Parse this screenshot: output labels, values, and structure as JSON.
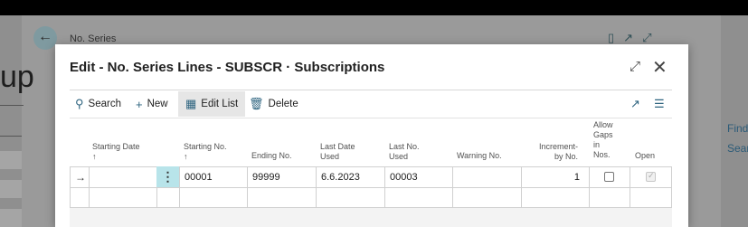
{
  "background": {
    "page_title": "No. Series",
    "partial_heading": "up",
    "right_links": [
      "Find",
      "Sear"
    ]
  },
  "dialog": {
    "title": "Edit - No. Series Lines - SUBSCR · Subscriptions",
    "toolbar": {
      "search": "Search",
      "new": "New",
      "edit_list": "Edit List",
      "delete": "Delete"
    },
    "columns": {
      "starting_date": "Starting Date",
      "starting_date_sort": "↑",
      "starting_no": "Starting No.",
      "starting_no_sort": "↑",
      "ending_no": "Ending No.",
      "last_date_used_1": "Last Date",
      "last_date_used_2": "Used",
      "last_no_used_1": "Last No.",
      "last_no_used_2": "Used",
      "warning_no": "Warning No.",
      "increment_1": "Increment-",
      "increment_2": "by No.",
      "allow_gaps_1": "Allow",
      "allow_gaps_2": "Gaps",
      "allow_gaps_3": "in",
      "allow_gaps_4": "Nos.",
      "open": "Open"
    },
    "rows": [
      {
        "starting_date": "",
        "starting_no": "00001",
        "ending_no": "99999",
        "last_date_used": "6.6.2023",
        "last_no_used": "00003",
        "warning_no": "",
        "increment_by_no": "1",
        "allow_gaps": false,
        "open": true
      }
    ]
  }
}
